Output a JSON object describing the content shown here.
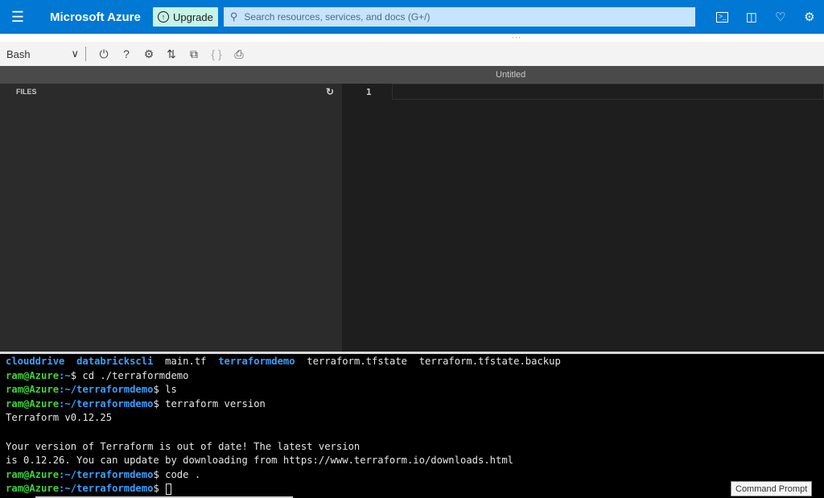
{
  "header": {
    "brand": "Microsoft Azure",
    "upgrade_label": "Upgrade",
    "search_placeholder": "Search resources, services, and docs (G+/)",
    "accent_color": "#0078d4"
  },
  "toolbar": {
    "shell": "Bash",
    "icons": [
      "power-icon",
      "help-icon",
      "settings-icon",
      "upload-download-icon",
      "open-new-session-icon",
      "braces-icon",
      "open-editor-icon"
    ]
  },
  "editor": {
    "tab_title": "Untitled",
    "files_title": "FILES",
    "line_number": "1"
  },
  "terminal": {
    "ls_output": {
      "dir1": "clouddrive",
      "dir2": "databrickscli",
      "file1": "main.tf",
      "dir3": "terraformdemo",
      "file2": "terraform.tfstate",
      "file3": "terraform.tfstate.backup"
    },
    "prompt_user": "ram@Azure",
    "path_home": ":~",
    "path_demo": ":~/terraformdemo",
    "cmd1": "$ cd ./terraformdemo",
    "cmd2": "$ ls",
    "cmd3": "$ terraform version",
    "out1": "Terraform v0.12.25",
    "out2": "Your version of Terraform is out of date! The latest version",
    "out3": "is 0.12.26. You can update by downloading from https://www.terraform.io/downloads.html",
    "cmd4": "$ code .",
    "cmd5": "$ "
  },
  "tooltip": "Command Prompt"
}
